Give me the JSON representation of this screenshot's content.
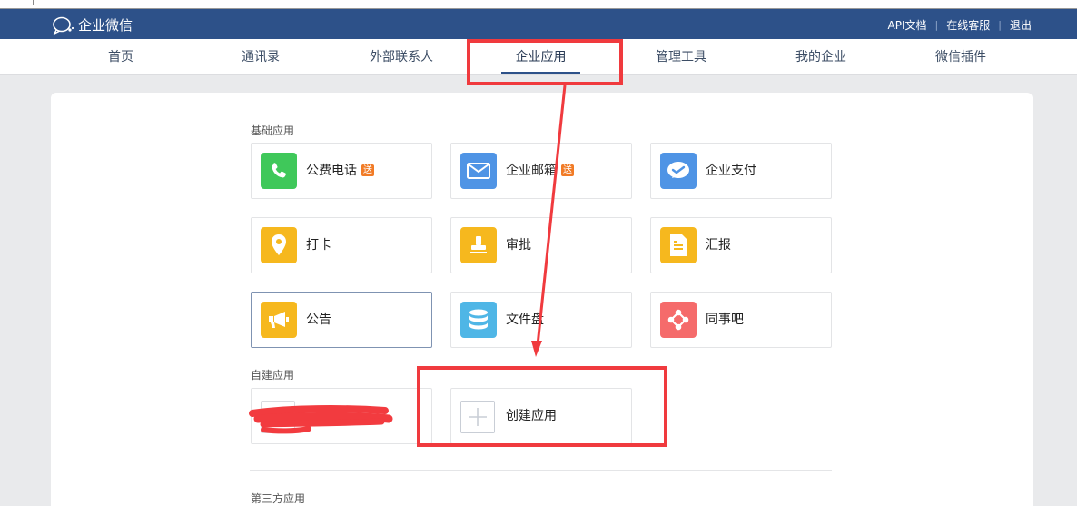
{
  "header": {
    "logo_text": "企业微信",
    "links": [
      "API文档",
      "在线客服",
      "退出"
    ]
  },
  "nav": {
    "items": [
      "首页",
      "通讯录",
      "外部联系人",
      "企业应用",
      "管理工具",
      "我的企业",
      "微信插件"
    ],
    "active": "企业应用"
  },
  "sections": {
    "basic": "基础应用",
    "custom": "自建应用",
    "third_party": "第三方应用"
  },
  "apps": [
    {
      "name": "公费电话",
      "badge": "送",
      "icon": "phone-icon",
      "color": "#3fc85a"
    },
    {
      "name": "企业邮箱",
      "badge": "送",
      "icon": "mail-icon",
      "color": "#4f94e5"
    },
    {
      "name": "企业支付",
      "badge": "",
      "icon": "pay-icon",
      "color": "#4f94e5"
    },
    {
      "name": "打卡",
      "badge": "",
      "icon": "location-pin-icon",
      "color": "#f6b81e"
    },
    {
      "name": "审批",
      "badge": "",
      "icon": "stamp-icon",
      "color": "#f6b81e"
    },
    {
      "name": "汇报",
      "badge": "",
      "icon": "report-icon",
      "color": "#f6b81e"
    },
    {
      "name": "公告",
      "badge": "",
      "icon": "megaphone-icon",
      "color": "#f6b81e"
    },
    {
      "name": "文件盘",
      "badge": "",
      "icon": "database-icon",
      "color": "#4fb6e6"
    },
    {
      "name": "同事吧",
      "badge": "",
      "icon": "network-icon",
      "color": "#f56b6b"
    }
  ],
  "create_app": {
    "label": "创建应用",
    "icon": "plus-icon"
  },
  "colors": {
    "header_bg": "#2d5189",
    "highlight_red": "#f03a3e"
  }
}
